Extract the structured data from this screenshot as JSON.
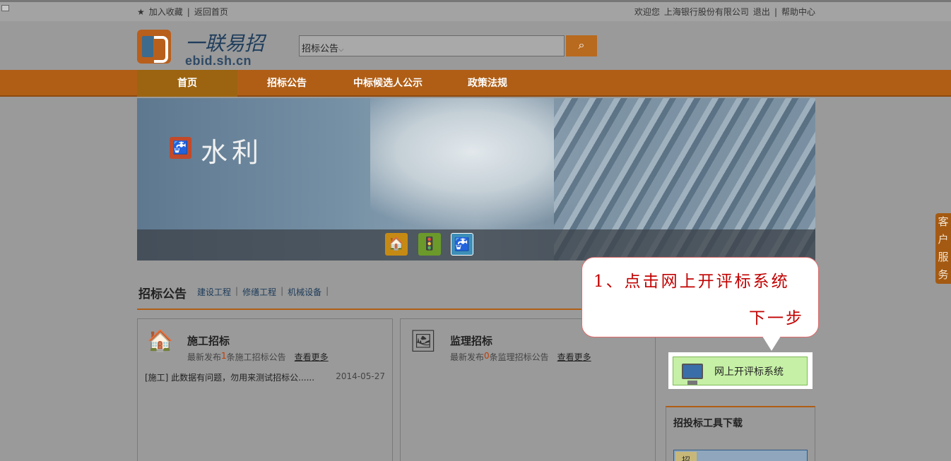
{
  "topbar": {
    "favorite": "加入收藏",
    "sep": "|",
    "home": "返回首页",
    "welcome": "欢迎您",
    "company": "上海银行股份有限公司",
    "logout": "退出",
    "help": "帮助中心"
  },
  "header": {
    "logo_cn": "一联易招",
    "logo_en": "ebid.sh.cn",
    "search_type": "招标公告",
    "search_value": ""
  },
  "nav": [
    "首页",
    "招标公告",
    "中标候选人公示",
    "政策法规"
  ],
  "banner": {
    "title": "水利"
  },
  "section": {
    "title": "招标公告",
    "links": [
      "建设工程",
      "修缮工程",
      "机械设备"
    ]
  },
  "cards": [
    {
      "name": "施工招标",
      "meta_prefix": "最新发布",
      "count": "1",
      "meta_suffix": "条施工招标公告",
      "more": "查看更多",
      "row_text": "[施工] 此数据有问题，勿用来测试招标公......",
      "row_date": "2014-05-27"
    },
    {
      "name": "监理招标",
      "meta_prefix": "最新发布",
      "count": "0",
      "meta_suffix": "条监理招标公告",
      "more": "查看更多",
      "row_text": "",
      "row_date": ""
    }
  ],
  "side": {
    "online_system": "网上开评标系统",
    "tools_title": "招投标工具下载",
    "tool_tag": "招"
  },
  "service_tab": "客户服务",
  "callout": {
    "line1": "1、点击网上开评标系统",
    "line2": "下一步"
  },
  "colors": {
    "nav": "#b05e16",
    "accent": "#c20000",
    "button": "#c6f0a6"
  }
}
